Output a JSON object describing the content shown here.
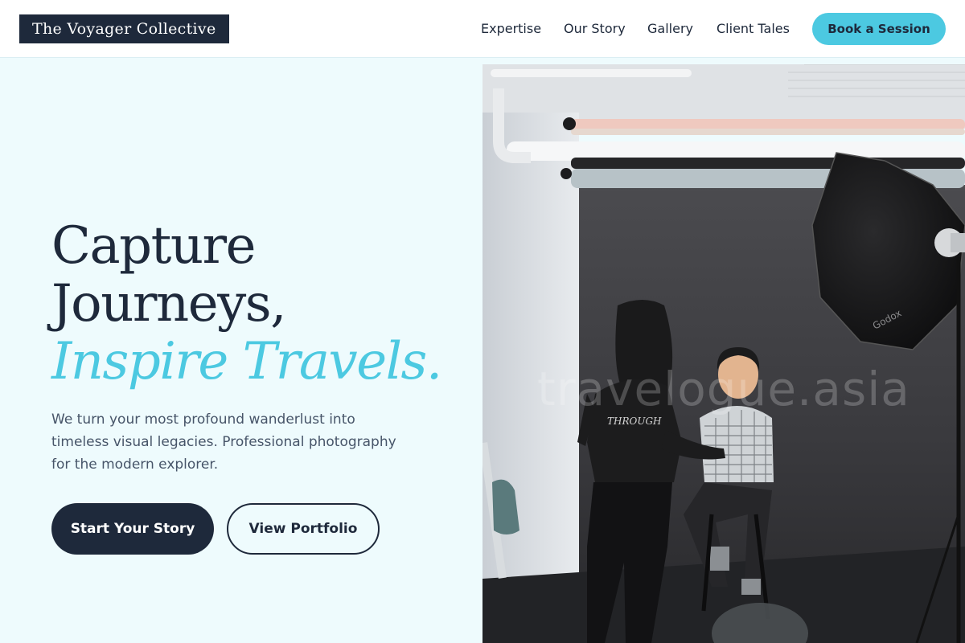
{
  "header": {
    "logo": "The Voyager Collective",
    "nav": [
      "Expertise",
      "Our Story",
      "Gallery",
      "Client Tales"
    ],
    "cta_label": "Book a Session"
  },
  "hero": {
    "title_line1": "Capture",
    "title_line2": "Journeys,",
    "title_accent": "Inspire Travels.",
    "description": "We turn your most profound wanderlust into timeless visual legacies. Professional photography for the modern explorer.",
    "primary_button": "Start Your Story",
    "secondary_button": "View Portfolio"
  },
  "photo": {
    "watermark": "travelogue.asia",
    "shirt_text": "THROUGH",
    "softbox_brand": "Godox"
  },
  "colors": {
    "navy": "#1e293b",
    "accent": "#4cc9e1",
    "background": "#eefbfd"
  }
}
